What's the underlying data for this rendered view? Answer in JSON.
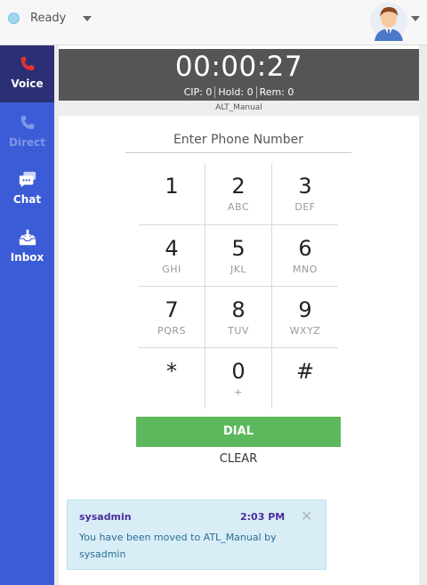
{
  "topbar": {
    "status": "Ready",
    "status_color": "#9fd6f2",
    "avatar_icon": "user-avatar"
  },
  "sidebar": {
    "items": [
      {
        "label": "Voice",
        "icon": "phone-icon",
        "state": "active"
      },
      {
        "label": "Direct",
        "icon": "phone-icon",
        "state": "disabled"
      },
      {
        "label": "Chat",
        "icon": "chat-icon",
        "state": "normal"
      },
      {
        "label": "Inbox",
        "icon": "inbox-icon",
        "state": "normal"
      }
    ]
  },
  "call": {
    "timer": "00:00:27",
    "cip": "CIP: 0",
    "hold": "Hold: 0",
    "rem": "Rem: 0",
    "queue": "ALT_Manual"
  },
  "dialer": {
    "placeholder": "Enter Phone Number",
    "keys": [
      {
        "digit": "1",
        "letters": ""
      },
      {
        "digit": "2",
        "letters": "ABC"
      },
      {
        "digit": "3",
        "letters": "DEF"
      },
      {
        "digit": "4",
        "letters": "GHI"
      },
      {
        "digit": "5",
        "letters": "JKL"
      },
      {
        "digit": "6",
        "letters": "MNO"
      },
      {
        "digit": "7",
        "letters": "PQRS"
      },
      {
        "digit": "8",
        "letters": "TUV"
      },
      {
        "digit": "9",
        "letters": "WXYZ"
      },
      {
        "digit": "*",
        "letters": ""
      },
      {
        "digit": "0",
        "letters": "+"
      },
      {
        "digit": "#",
        "letters": ""
      }
    ],
    "dial_label": "DIAL",
    "clear_label": "CLEAR"
  },
  "notification": {
    "user": "sysadmin",
    "time": "2:03 PM",
    "message": "You have been moved to ATL_Manual by sysadmin",
    "close": "✕"
  },
  "colors": {
    "sidebar": "#3b5cd6",
    "sidebar_active": "#2b2f73",
    "dial": "#5cb85c",
    "timer_bg": "#555557"
  }
}
